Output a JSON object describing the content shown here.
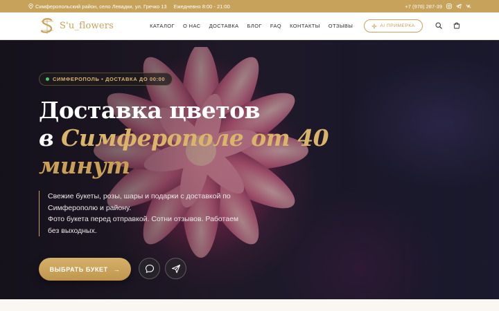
{
  "topbar": {
    "address": "Симферопольский район, село Левадки, ул. Гречко 13",
    "hours": "Ежедневно 8:00 - 21:00",
    "phone": "+7 (978) 287-39",
    "socials": [
      "instagram-icon",
      "telegram-icon",
      "vk-icon"
    ]
  },
  "header": {
    "logo_text": "S'u_flowers",
    "nav": [
      "КАТАЛОГ",
      "О НАС",
      "ДОСТАВКА",
      "БЛОГ",
      "FAQ",
      "КОНТАКТЫ",
      "ОТЗЫВЫ"
    ],
    "ai_button": "AI ПРИМЕРКА",
    "icons": [
      "search-icon",
      "cart-icon"
    ]
  },
  "hero": {
    "badge": "СИМФЕРОПОЛЬ • ДОСТАВКА ДО 00:00",
    "title_line1": "Доставка цветов",
    "title_line2_white": "в ",
    "title_line2_gold": "Симферополе от 40",
    "title_line3": "минут",
    "desc_p1": "Свежие букеты, розы, шары и подарки с доставкой по Симферополю и району.",
    "desc_p2": "Фото букета перед отправкой. Сотни отзывов. Работаем без выходных.",
    "cta_label": "ВЫБРАТЬ БУКЕТ",
    "cta_arrow": "→"
  },
  "colors": {
    "accent": "#c7a25a",
    "gold_text": "#d9b46a",
    "hero_dark": "#1d1826",
    "status_green": "#3ecf6a"
  }
}
